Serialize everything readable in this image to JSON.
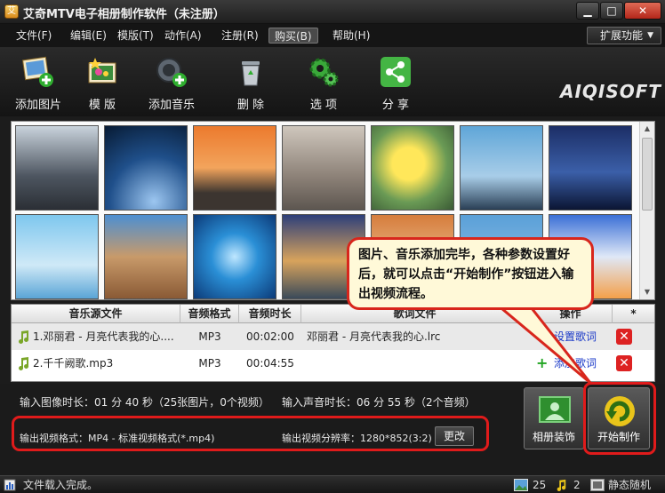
{
  "window": {
    "title": "艾奇MTV电子相册制作软件（未注册）",
    "minimize": "▁",
    "maximize": "□",
    "close": "✕"
  },
  "menu": {
    "items": [
      "文件(F)",
      "编辑(E)",
      "模版(T)",
      "动作(A)",
      "注册(R)",
      "购买(B)",
      "帮助(H)"
    ],
    "active": "购买(B)",
    "extension": "扩展功能"
  },
  "toolbar": {
    "add_image": "添加图片",
    "template": "模 版",
    "add_music": "添加音乐",
    "delete": "删 除",
    "options": "选 项",
    "share": "分 享",
    "logo": "AIQISOFT"
  },
  "music_table": {
    "headers": [
      "音乐源文件",
      "音频格式",
      "音频时长",
      "歌词文件",
      "操作",
      "*"
    ],
    "rows": [
      {
        "file": "1.邓丽君 - 月亮代表我的心....",
        "format": "MP3",
        "duration": "00:02:00",
        "lyric": "邓丽君 - 月亮代表我的心.lrc",
        "action": "设置歌词"
      },
      {
        "file": "2.千千阙歌.mp3",
        "format": "MP3",
        "duration": "00:04:55",
        "lyric": "",
        "action": "添加歌词"
      }
    ]
  },
  "info": {
    "image_duration": "输入图像时长：01 分 40 秒（25张图片，0个视频）",
    "audio_duration": "输入声音时长：06 分 55 秒（2个音频）",
    "output_format": "输出视频格式：MP4 - 标准视频格式(*.mp4)",
    "output_resolution": "输出视频分辨率：1280*852(3:2)",
    "change": "更改",
    "album_decoration": "相册装饰",
    "start": "开始制作"
  },
  "tooltip": "图片、音乐添加完毕，各种参数设置好后，就可以点击“开始制作”按钮进入输出视频流程。",
  "status": {
    "message": "文件载入完成。",
    "image_count": "25",
    "audio_count": "2",
    "mode": "静态随机"
  },
  "colors": {
    "highlight_red": "#e01b1b",
    "link_blue": "#1a39c8"
  }
}
